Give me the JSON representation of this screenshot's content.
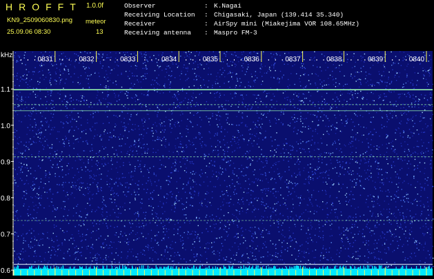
{
  "header": {
    "app_title": "HROFFT",
    "version": "1.0.0f",
    "filename": "KN9_2509060830.png",
    "meteor_label": "meteor",
    "meteor_count": "13",
    "datetime": "25.09.06 08:30"
  },
  "info": [
    {
      "key": "Observer",
      "sep": ":",
      "value": "K.Nagai"
    },
    {
      "key": "Receiving Location",
      "sep": ":",
      "value": "Chigasaki, Japan (139.414 35.340)"
    },
    {
      "key": "Receiver",
      "sep": ":",
      "value": "AirSpy mini (Miakejima VOR 108.65MHz)"
    },
    {
      "key": "Receiving antenna",
      "sep": ":",
      "value": "Maspro FM-3"
    }
  ],
  "chart_data": {
    "type": "heatmap",
    "ylabel": "kHz",
    "y_ticks": [
      "1.1",
      "1.0",
      "0.9",
      "0.8",
      "0.7",
      "0.6"
    ],
    "y_tick_values": [
      1.1,
      1.0,
      0.9,
      0.8,
      0.7,
      0.6
    ],
    "ylim": [
      0.585,
      1.205
    ],
    "x_ticks": [
      "0831",
      "0832",
      "0833",
      "0834",
      "0835",
      "0836",
      "0837",
      "0838",
      "0839",
      "0840"
    ],
    "xlim_minutes": [
      30.0,
      40.15
    ],
    "signal_lines_khz": [
      1.098,
      1.057,
      1.04,
      0.913,
      0.737,
      0.616,
      0.597
    ],
    "colors": {
      "background": "#0a0f6e",
      "noise_low": "#2a3bd0",
      "noise_high": "#8fd0ff",
      "signal": "#9dffb0",
      "bottom_band": "#00e8ff",
      "marker": "#ffff55",
      "text": "#ffffff"
    }
  }
}
